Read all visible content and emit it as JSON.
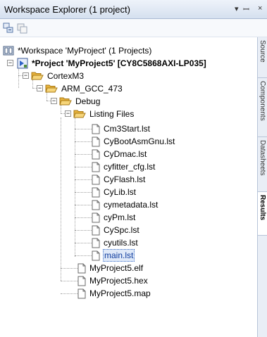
{
  "panel": {
    "title": "Workspace Explorer (1 project)",
    "pin_glyph": "▾ ⊥",
    "close_glyph": "×"
  },
  "toolbar": {
    "buttons": [
      {
        "icon": "collapse-all-icon"
      },
      {
        "icon": "refresh-icon"
      }
    ]
  },
  "tree": {
    "workspace": "*Workspace 'MyProject' (1 Projects)",
    "project": "*Project 'MyProject5' [CY8C5868AXI-LP035]",
    "folders": {
      "cortex": "CortexM3",
      "arm": "ARM_GCC_473",
      "debug": "Debug",
      "listing": "Listing Files"
    },
    "listing_files": [
      "Cm3Start.lst",
      "CyBootAsmGnu.lst",
      "CyDmac.lst",
      "cyfitter_cfg.lst",
      "CyFlash.lst",
      "CyLib.lst",
      "cymetadata.lst",
      "cyPm.lst",
      "CySpc.lst",
      "cyutils.lst",
      "main.lst"
    ],
    "selected_file": "main.lst",
    "output_files": [
      "MyProject5.elf",
      "MyProject5.hex",
      "MyProject5.map"
    ]
  },
  "side_tabs": [
    {
      "label": "Source",
      "active": false
    },
    {
      "label": "Components",
      "active": false
    },
    {
      "label": "Datasheets",
      "active": false
    },
    {
      "label": "Results",
      "active": true
    }
  ],
  "colors": {
    "selection_text": "#0f3c9e",
    "folder": "#f2c450",
    "header": "#d5e0ef"
  }
}
